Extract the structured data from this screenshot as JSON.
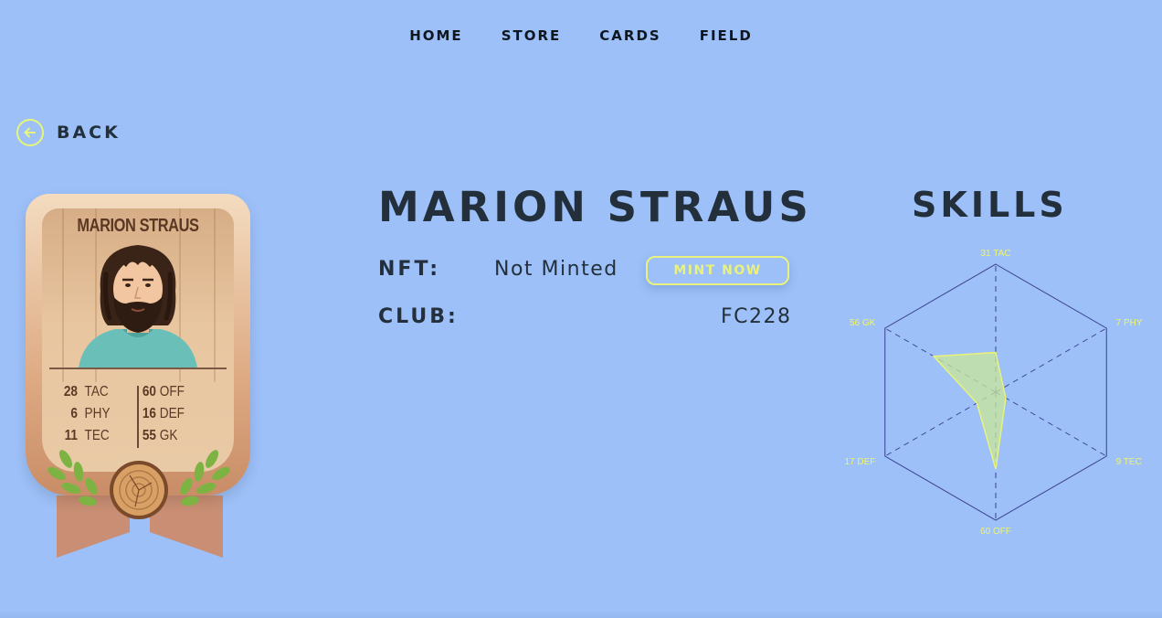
{
  "nav": {
    "items": [
      "HOME",
      "STORE",
      "CARDS",
      "FIELD"
    ]
  },
  "back": {
    "label": "BACK",
    "icon": "arrow-left-icon"
  },
  "card": {
    "name": "MARION STRAUS",
    "stats_left": [
      {
        "value": "28",
        "label": "TAC"
      },
      {
        "value": "6",
        "label": "PHY"
      },
      {
        "value": "11",
        "label": "TEC"
      }
    ],
    "stats_right": [
      {
        "value": "60",
        "label": "OFF"
      },
      {
        "value": "16",
        "label": "DEF"
      },
      {
        "value": "55",
        "label": "GK"
      }
    ]
  },
  "player": {
    "name": "MARION STRAUS",
    "nft_label": "NFT:",
    "nft_value": "Not Minted",
    "mint_button": "MINT NOW",
    "club_label": "CLUB:",
    "club_value": "FC228"
  },
  "skills": {
    "title": "SKILLS",
    "axes": [
      {
        "label": "31 TAC",
        "value": 31
      },
      {
        "label": "7 PHY",
        "value": 7
      },
      {
        "label": "9 TEC",
        "value": 9
      },
      {
        "label": "60 OFF",
        "value": 60
      },
      {
        "label": "17 DEF",
        "value": 17
      },
      {
        "label": "56 GK",
        "value": 56
      }
    ],
    "max": 100
  },
  "colors": {
    "background": "#9dc0f8",
    "accent": "#e9f27a",
    "text": "#23303c",
    "radar_line": "#3a3f8f",
    "radar_fill": "#c9e89a"
  }
}
